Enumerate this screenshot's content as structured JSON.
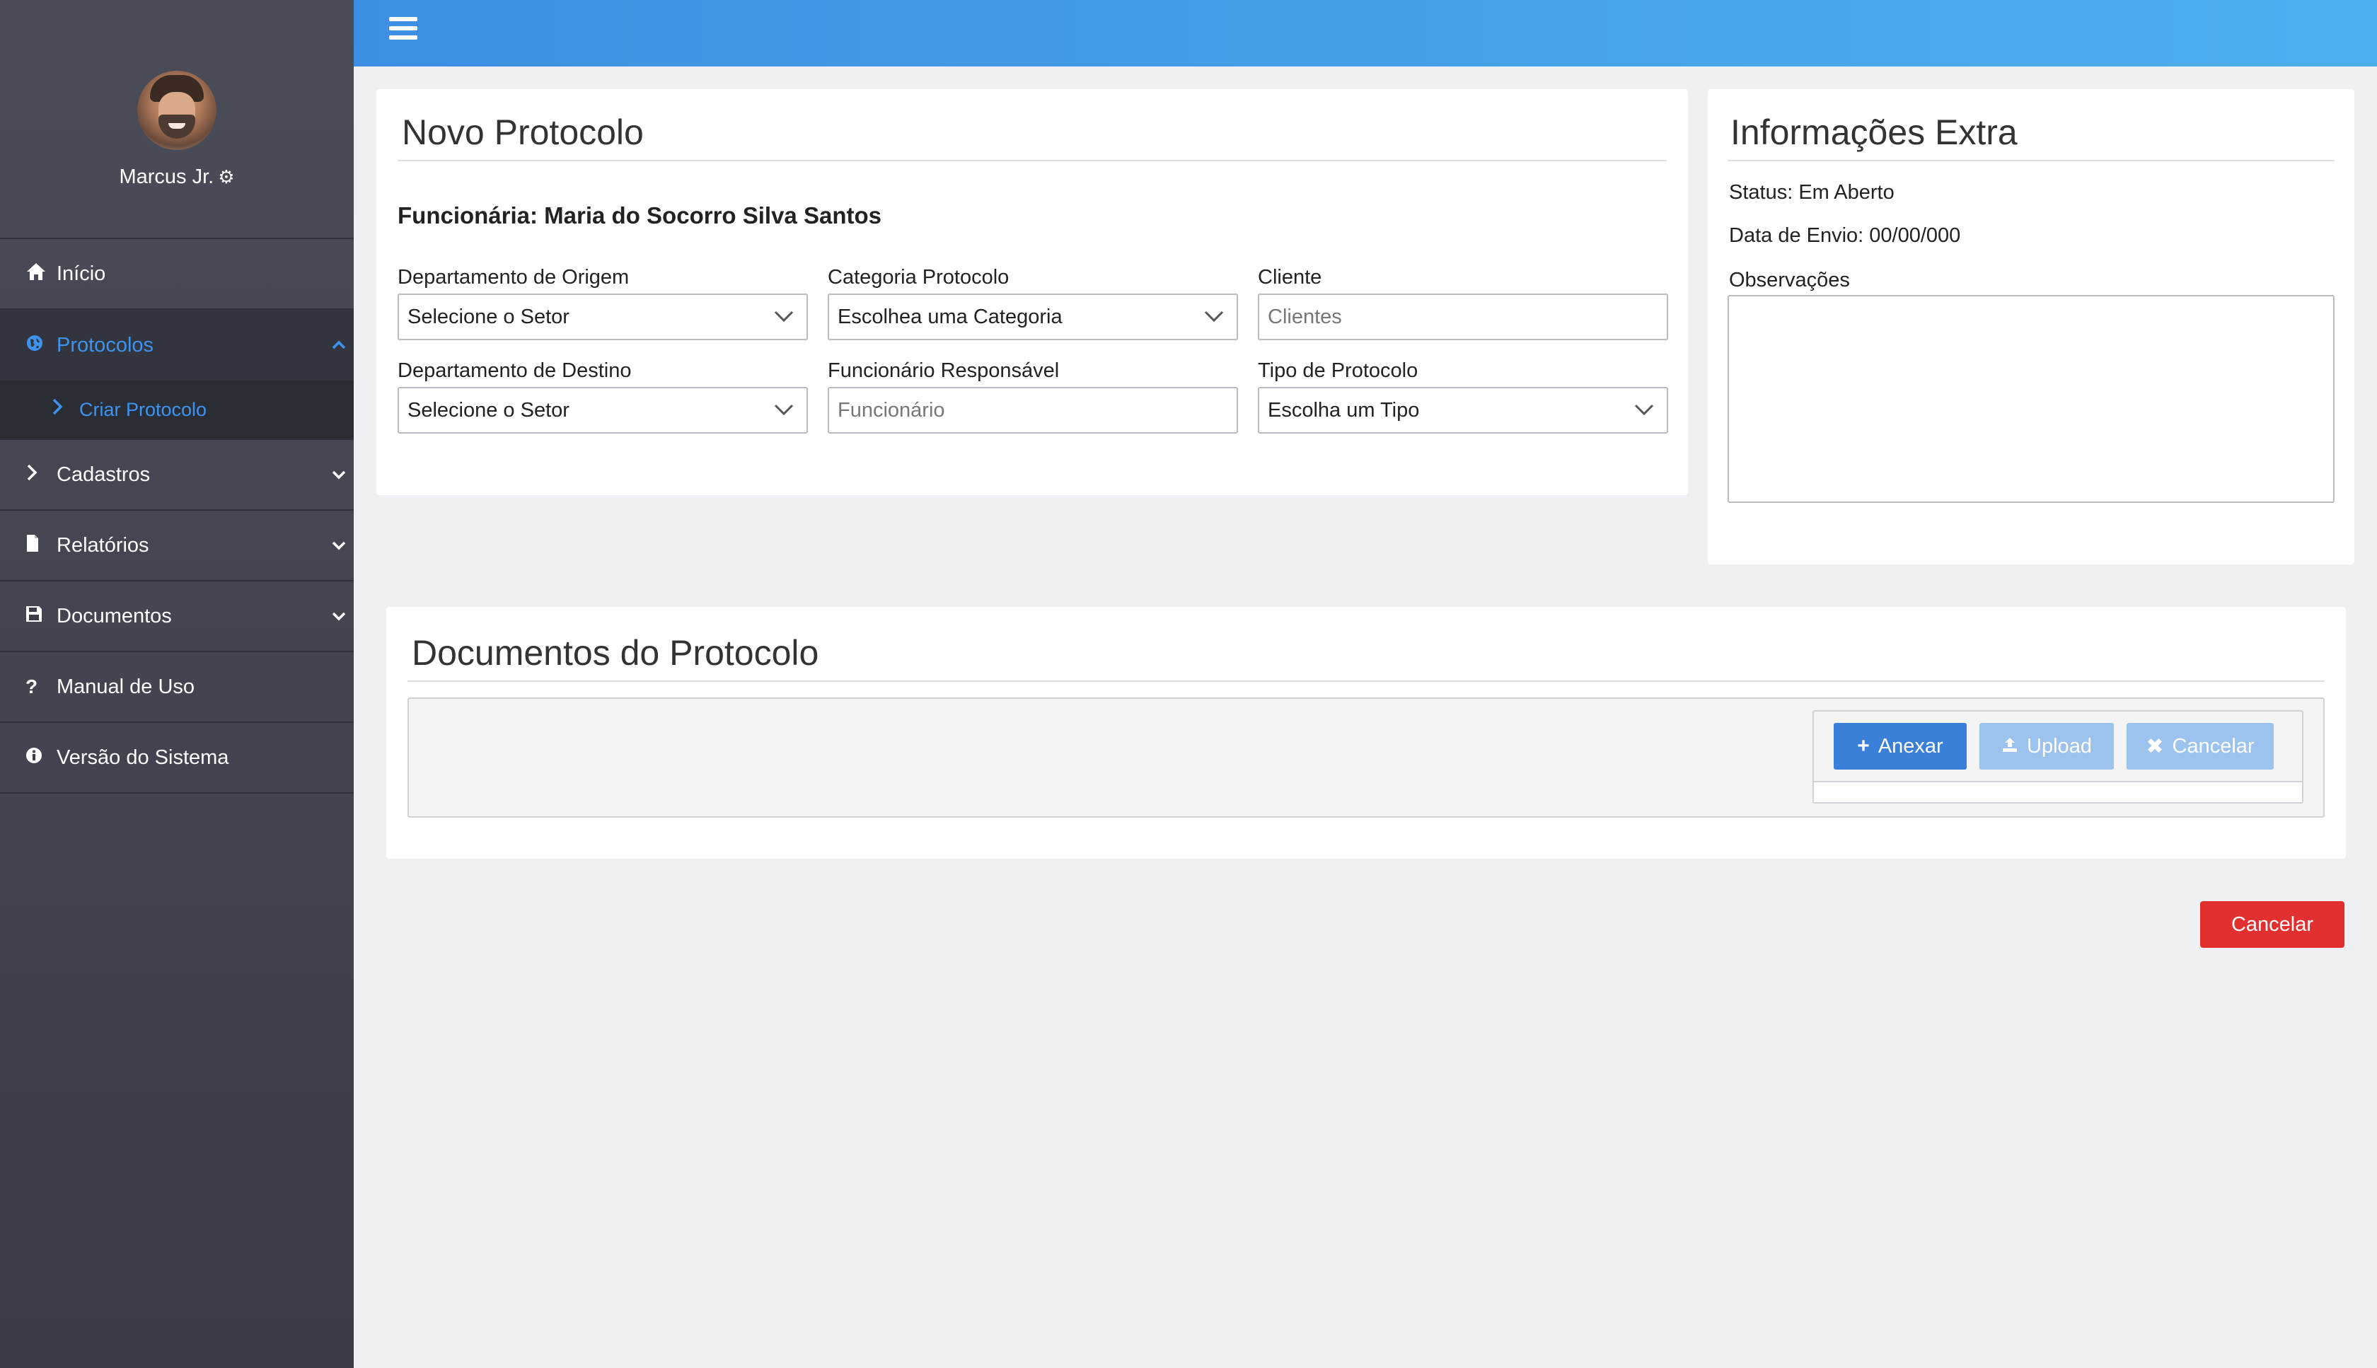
{
  "user": {
    "name": "Marcus Jr."
  },
  "sidebar": {
    "items": [
      {
        "label": "Início",
        "icon": "home-icon"
      },
      {
        "label": "Protocolos",
        "icon": "globe-icon",
        "active": true,
        "subitems": [
          {
            "label": "Criar Protocolo",
            "icon": "chevron-right-icon"
          }
        ]
      },
      {
        "label": "Cadastros",
        "icon": "chevron-right-icon"
      },
      {
        "label": "Relatórios",
        "icon": "file-icon"
      },
      {
        "label": "Documentos",
        "icon": "save-icon"
      },
      {
        "label": "Manual de Uso",
        "icon": "question-icon"
      },
      {
        "label": "Versão do Sistema",
        "icon": "info-icon"
      }
    ]
  },
  "novo": {
    "title": "Novo Protocolo",
    "employee": "Funcionária: Maria do Socorro Silva Santos",
    "fields": {
      "origem": {
        "label": "Departamento de Origem",
        "value": "Selecione o Setor"
      },
      "categoria": {
        "label": "Categoria Protocolo",
        "value": "Escolhea uma Categoria"
      },
      "cliente": {
        "label": "Cliente",
        "placeholder": "Clientes"
      },
      "destino": {
        "label": "Departamento de Destino",
        "value": "Selecione o Setor"
      },
      "responsavel": {
        "label": "Funcionário Responsável",
        "placeholder": "Funcionário"
      },
      "tipo": {
        "label": "Tipo de Protocolo",
        "value": "Escolha um Tipo"
      }
    }
  },
  "info": {
    "title": "Informações Extra",
    "status": "Status: Em Aberto",
    "data_envio": "Data de Envio: 00/00/000",
    "obs_label": "Observações"
  },
  "docs": {
    "title": "Documentos do Protocolo",
    "anexar": "Anexar",
    "upload": "Upload",
    "cancelar": "Cancelar"
  },
  "footer": {
    "cancel": "Cancelar"
  },
  "colors": {
    "accent": "#3d94f0",
    "primary_button": "#3a7fd8",
    "disabled_button": "#9cc2ee",
    "danger_button": "#e22f2f"
  }
}
